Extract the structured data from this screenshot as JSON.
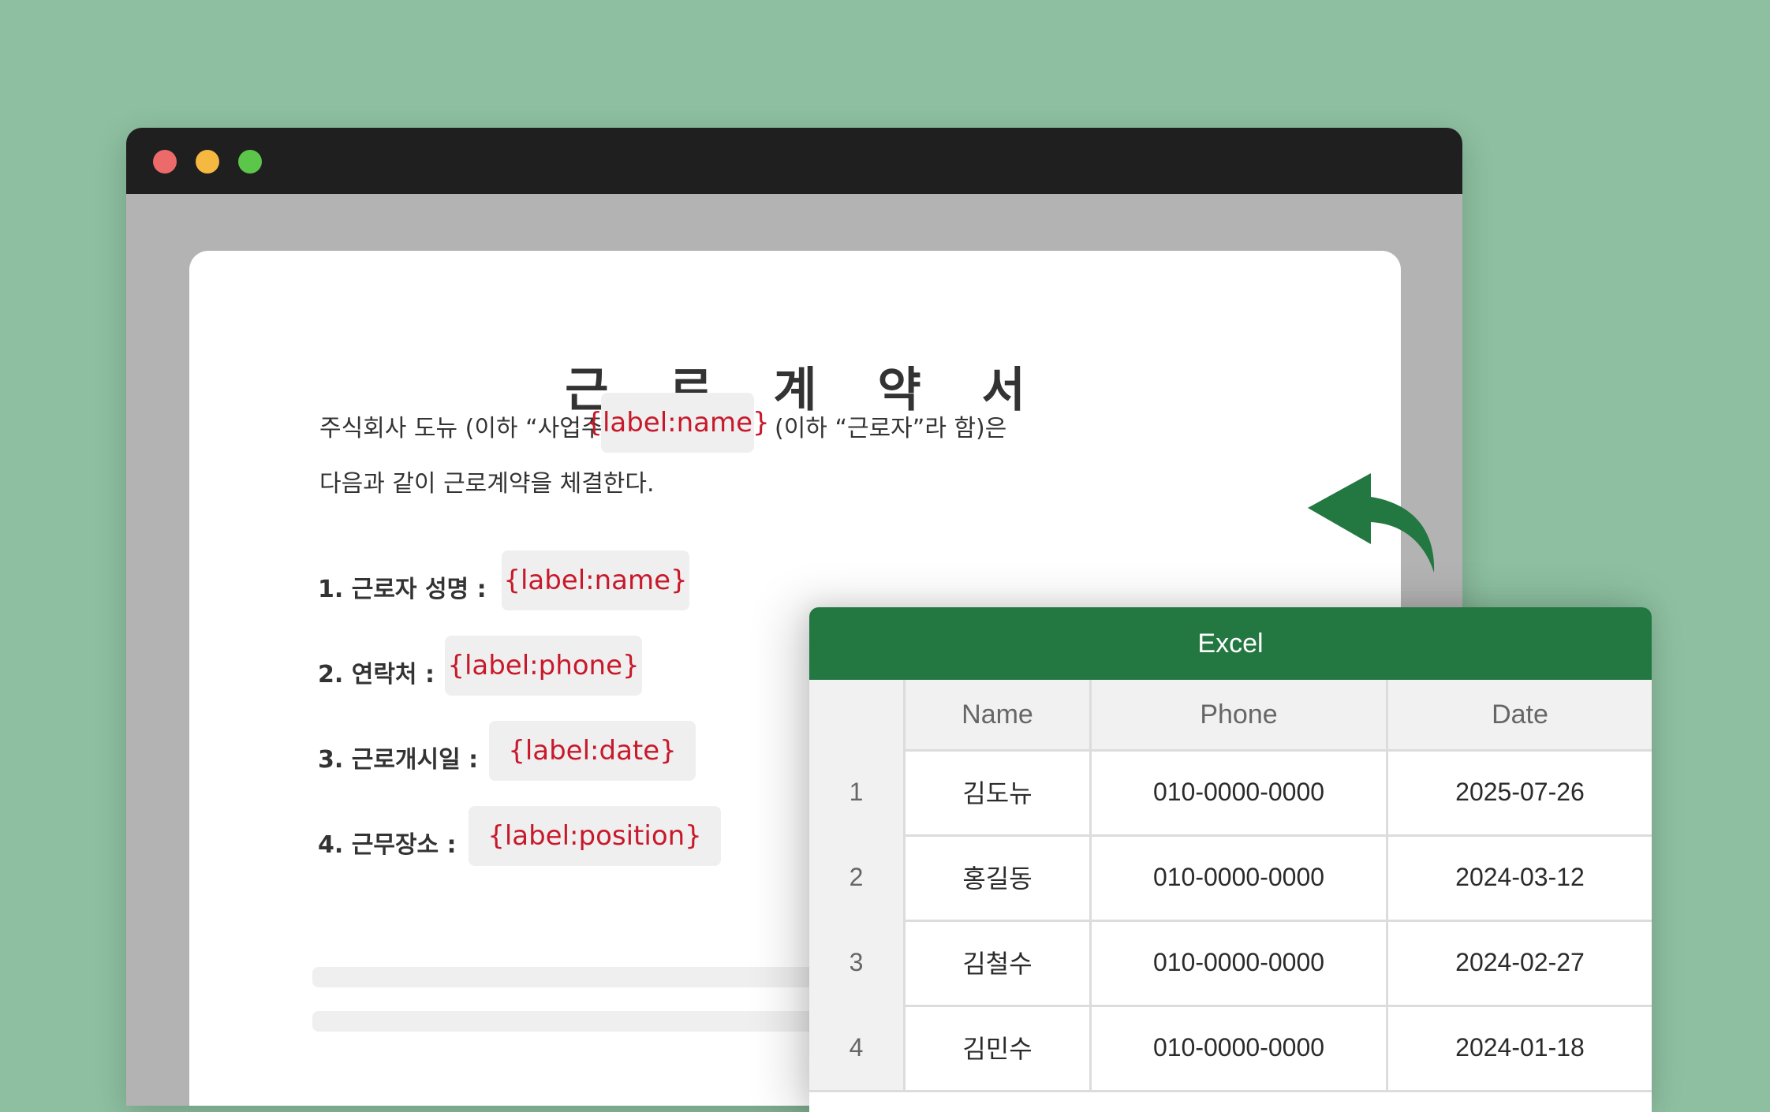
{
  "window": {
    "controls": [
      "close",
      "minimize",
      "maximize"
    ]
  },
  "document": {
    "title": "근 로 계 약 서",
    "intro_part1": "주식회사 도뉴 (이하 “사업주”라 함)과(와)",
    "intro_chip": "{label:name}",
    "intro_part2": "(이하 “근로자”라 함)은",
    "intro_line2": "다음과 같이 근로계약을 체결한다.",
    "fields": [
      {
        "label": "1. 근로자 성명 :",
        "placeholder": "{label:name}"
      },
      {
        "label": "2. 연락처 :",
        "placeholder": "{label:phone}"
      },
      {
        "label": "3. 근로개시일 :",
        "placeholder": "{label:date}"
      },
      {
        "label": "4. 근무장소 :",
        "placeholder": "{label:position}"
      }
    ]
  },
  "excel": {
    "title": "Excel",
    "columns": [
      "",
      "Name",
      "Phone",
      "Date"
    ],
    "rows": [
      [
        "1",
        "김도뉴",
        "010-0000-0000",
        "2025-07-26"
      ],
      [
        "2",
        "홍길동",
        "010-0000-0000",
        "2024-03-12"
      ],
      [
        "3",
        "김철수",
        "010-0000-0000",
        "2024-02-27"
      ],
      [
        "4",
        "김민수",
        "010-0000-0000",
        "2024-01-18"
      ]
    ]
  },
  "colors": {
    "background": "#8dbfa0",
    "excel_green": "#237842",
    "placeholder_red": "#c8192b",
    "arrow_green": "#237842"
  },
  "icons": {
    "return_arrow": "curved-return-arrow-icon"
  }
}
